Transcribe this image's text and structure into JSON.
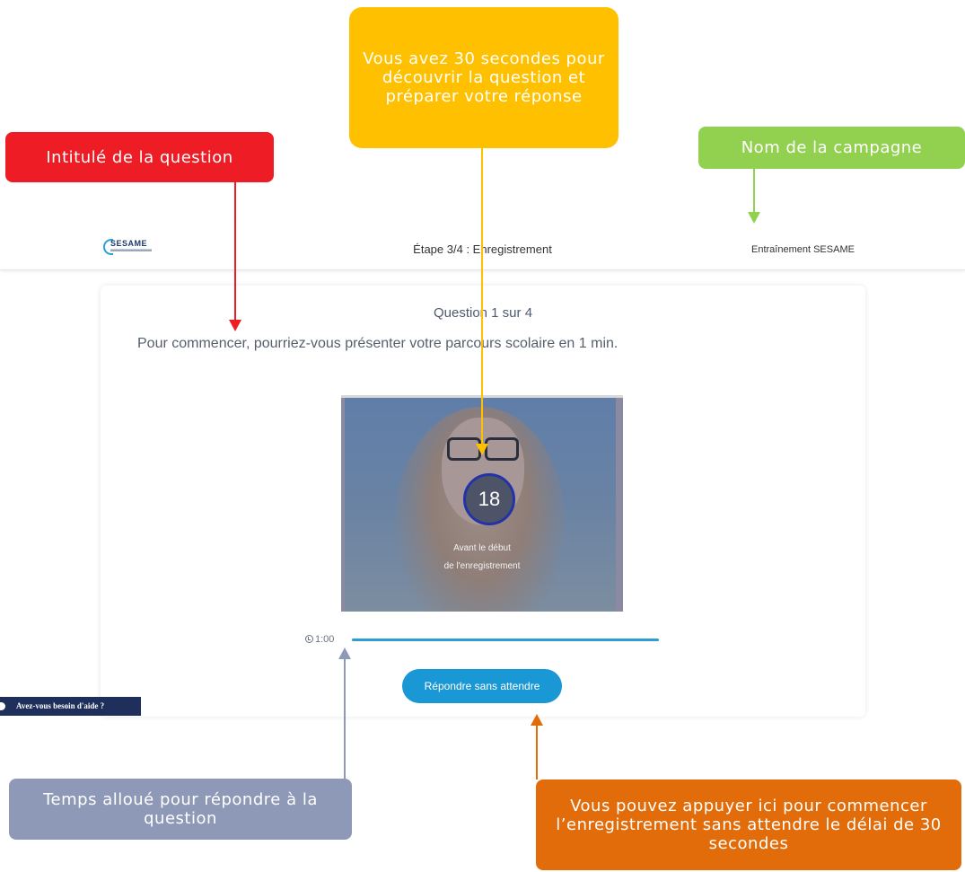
{
  "header": {
    "logo_text": "SESAME",
    "step_title": "Étape 3/4 : Enregistrement",
    "campaign_name": "Entraînement SESAME"
  },
  "question": {
    "counter": "Question 1 sur 4",
    "text": "Pour commencer, pourriez-vous présenter votre parcours scolaire en 1 min."
  },
  "video": {
    "countdown": "18",
    "caption_line1": "Avant le début",
    "caption_line2": "de l'enregistrement"
  },
  "timer": {
    "value": "1:00",
    "progress_fraction": 1.0
  },
  "buttons": {
    "answer_now": "Répondre sans attendre"
  },
  "help": {
    "label": "Avez-vous besoin d'aide ?"
  },
  "callouts": {
    "question_title": "Intitulé de la question",
    "prep_time": "Vous avez 30 secondes pour découvrir la question et préparer votre réponse",
    "campaign": "Nom de la campagne",
    "allotted_time": "Temps alloué pour répondre à la question",
    "skip_wait": "Vous pouvez appuyer ici pour commencer l’enregistrement sans attendre le délai de 30 secondes"
  },
  "colors": {
    "red": "#ee1c24",
    "yellow": "#ffc000",
    "green": "#92d050",
    "grey": "#8e99b8",
    "orange": "#e36c0a",
    "accent": "#1a98d5"
  }
}
